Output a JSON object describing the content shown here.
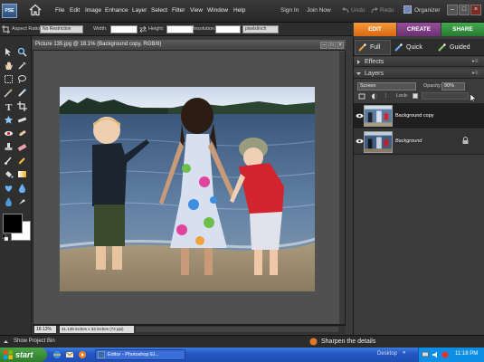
{
  "app": {
    "logo": "PSE"
  },
  "menu": [
    "File",
    "Edit",
    "Image",
    "Enhance",
    "Layer",
    "Select",
    "Filter",
    "View",
    "Window",
    "Help"
  ],
  "top_links": {
    "sign_in": "Sign In",
    "join_now": "Join Now",
    "undo": "Undo",
    "redo": "Redo",
    "organizer": "Organizer"
  },
  "options_bar": {
    "aspect_ratio_label": "Aspect Ratio:",
    "aspect_ratio_value": "No Restriction",
    "width_label": "Width:",
    "height_label": "Height:",
    "resolution_label": "Resolution:",
    "resolution_unit": "pixels/inch"
  },
  "mode_tabs": [
    {
      "label": "EDIT",
      "color": "#e8741c"
    },
    {
      "label": "CREATE",
      "color": "#7a3c7a"
    },
    {
      "label": "SHARE",
      "color": "#2f8d3a"
    }
  ],
  "edit_tabs": {
    "full": "Full",
    "quick": "Quick",
    "guided": "Guided"
  },
  "document": {
    "title": "Picture 135.jpg @ 18.1% (Background copy, RGB/8)",
    "zoom": "18.13%",
    "info": "41.139 inches x 33 inches (72 ppi)"
  },
  "panels": {
    "effects": "Effects",
    "layers": "Layers",
    "blend_mode": "Screen",
    "opacity_label": "Opacity:",
    "opacity_value": "90%",
    "lock_label": "Lock:",
    "layers_list": [
      {
        "name": "Background copy"
      },
      {
        "name": "Background"
      }
    ]
  },
  "bottom": {
    "project_bin": "Show Project Bin",
    "hint": "Sharpen the details"
  },
  "taskbar": {
    "start": "start",
    "task": "Editor - Photoshop El...",
    "desktop": "Desktop",
    "clock": "11:18 PM"
  }
}
